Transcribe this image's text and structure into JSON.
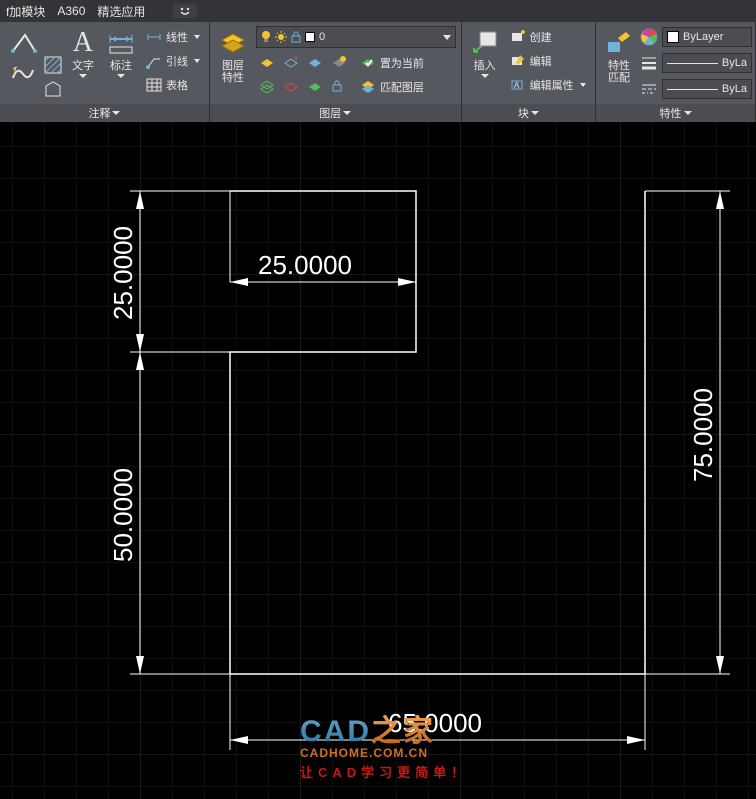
{
  "tabs": {
    "addon": "f加模块",
    "a360": "A360",
    "apps": "精选应用"
  },
  "panels": {
    "annotate": {
      "title": "注释",
      "text": "文字",
      "dim": "标注",
      "linear": "线性",
      "leader": "引线",
      "table": "表格"
    },
    "layers": {
      "title": "图层",
      "props": "图层\n特性",
      "current": "0",
      "setcurrent": "置为当前",
      "match": "匹配图层"
    },
    "block": {
      "title": "块",
      "insert": "插入",
      "create": "创建",
      "edit": "编辑",
      "attr": "编辑属性"
    },
    "props": {
      "title": "特性",
      "btn": "特性\n匹配",
      "bylayer": "ByLayer",
      "bylayer2": "ByLa",
      "bylayer3": "ByLa"
    }
  },
  "dims": {
    "d25a": "25.0000",
    "d25b": "25.0000",
    "d50": "50.0000",
    "d65": "65.0000",
    "d75": "75.0000"
  },
  "watermark": {
    "line1a": "CAD",
    "line1b": "之家",
    "line2": "CADHOME.COM.CN",
    "line3": "让CAD学习更简单！"
  }
}
